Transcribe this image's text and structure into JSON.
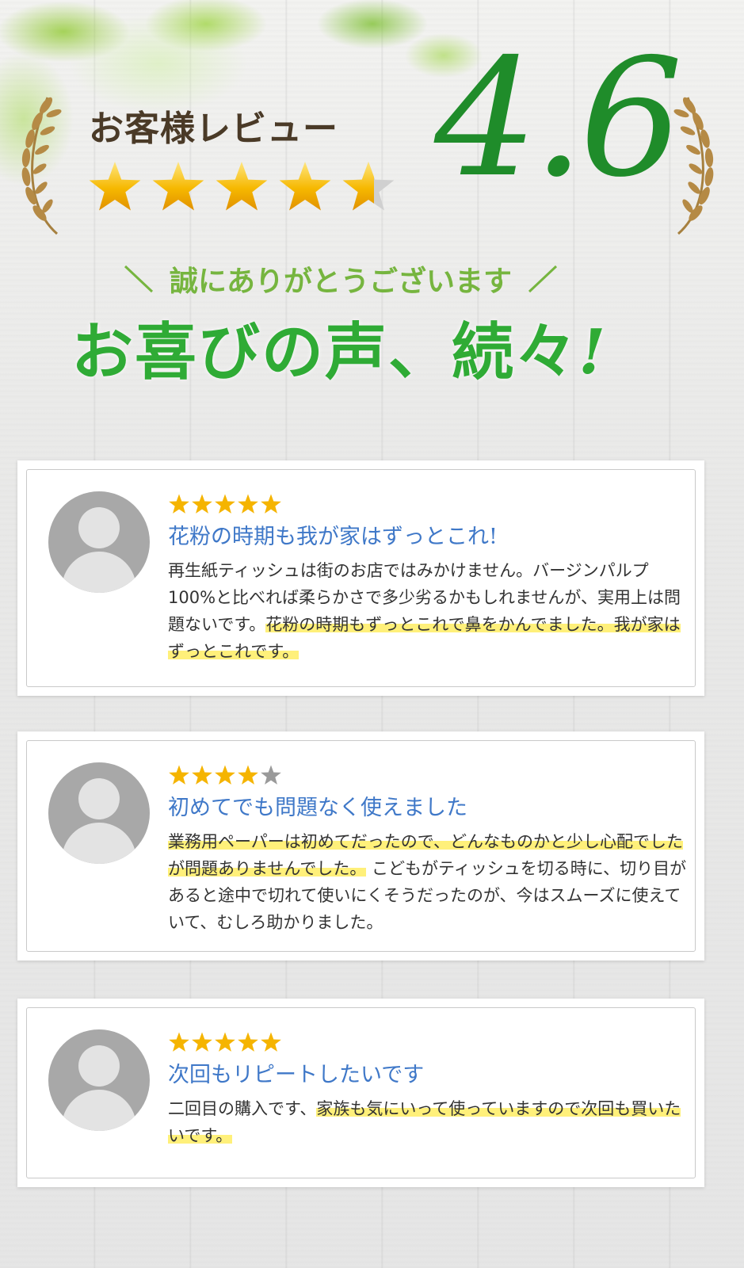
{
  "header": {
    "review_label": "お客様レビュー",
    "rating": "4.6",
    "rating_stars": 4.6,
    "thanks": "誠にありがとうございます",
    "headline": "お喜びの声、続々",
    "headline_mark": "!"
  },
  "colors": {
    "rating_green": "#1f8c2a",
    "headline_green": "#2fab35",
    "thanks_green": "#76b53f",
    "title_blue": "#3f78c8",
    "highlight_yellow": "#fff07a",
    "star_gold": "#f5b400"
  },
  "reviews": [
    {
      "stars": 5,
      "title": "花粉の時期も我が家はずっとこれ!",
      "text_plain": "再生紙ティッシュは街のお店ではみかけません。バージンパルプ100%と比べれば柔らかさで多少劣るかもしれませんが、実用上は問題ないです。",
      "text_highlight": "花粉の時期もずっとこれで鼻をかんでました。我が家はずっとこれです。",
      "avatar_icon": "user-avatar-icon"
    },
    {
      "stars": 4,
      "title": "初めてでも問題なく使えました",
      "text_highlight": "業務用ペーパーは初めてだったので、どんなものかと少し心配でしたが問題ありませんでした。",
      "text_plain": " こどもがティッシュを切る時に、切り目があると途中で切れて使いにくそうだったのが、今はスムーズに使えていて、むしろ助かりました。",
      "avatar_icon": "user-avatar-icon"
    },
    {
      "stars": 5,
      "title": "次回もリピートしたいです",
      "text_plain": "二回目の購入です、",
      "text_highlight": "家族も気にいって使っていますので次回も買いたいです。",
      "avatar_icon": "user-avatar-icon"
    }
  ]
}
